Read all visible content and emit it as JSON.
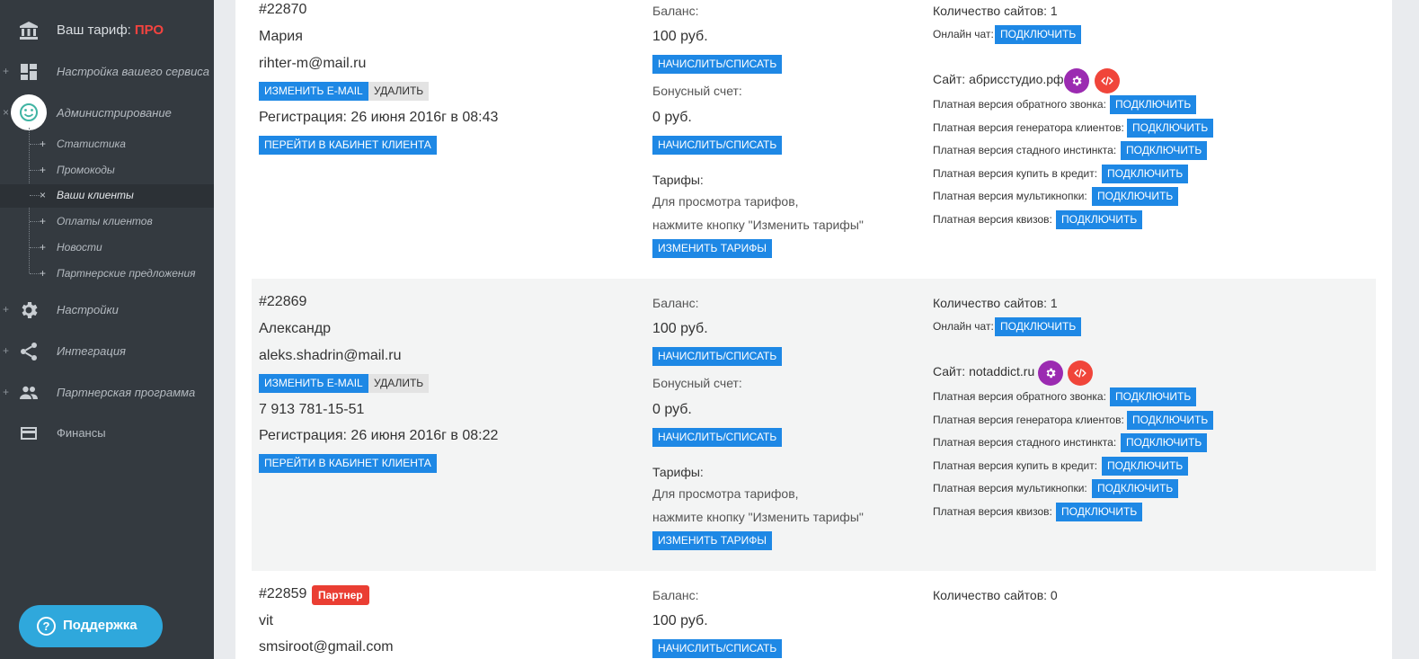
{
  "sidebar": {
    "plan_label": "Ваш тариф:",
    "plan_value": "ПРО",
    "items": [
      {
        "label": "Настройка вашего сервиса",
        "toggle": "+"
      },
      {
        "label": "Администрирование",
        "toggle": "×"
      },
      {
        "label": "Настройки",
        "toggle": "+"
      },
      {
        "label": "Интеграция",
        "toggle": "+"
      },
      {
        "label": "Партнерская программа",
        "toggle": "+"
      },
      {
        "label": "Финансы",
        "toggle": ""
      }
    ],
    "subitems": [
      {
        "label": "Статистика",
        "mark": "+"
      },
      {
        "label": "Промокоды",
        "mark": "+"
      },
      {
        "label": "Ваши клиенты",
        "mark": "×"
      },
      {
        "label": "Оплаты клиентов",
        "mark": "+"
      },
      {
        "label": "Новости",
        "mark": "+"
      },
      {
        "label": "Партнерские предложения",
        "mark": "+"
      }
    ],
    "support_label": "Поддержка",
    "support_icon": "?"
  },
  "labels": {
    "change_email": "ИЗМЕНИТЬ E-MAIL",
    "delete": "УДАЛИТЬ",
    "go_cabinet": "ПЕРЕЙТИ В КАБИНЕТ КЛИЕНТА",
    "balance": "Баланс:",
    "bonus": "Бонусный счет:",
    "charge": "НАЧИСЛИТЬ/СПИСАТЬ",
    "tariffs": "Тарифы:",
    "tariffs_hint_1": "Для просмотра тарифов,",
    "tariffs_hint_2": "нажмите кнопку \"Изменить тарифы\"",
    "change_tariffs": "ИЗМЕНИТЬ ТАРИФЫ",
    "connect": "ПОДКЛЮЧИТЬ",
    "online_chat": "Онлайн чат:",
    "site_prefix": "Сайт:",
    "paid_callback": "Платная версия обратного звонка:",
    "paid_generator": "Платная версия генератора клиентов:",
    "paid_herd": "Платная версия стадного инстинкта:",
    "paid_credit": "Платная версия купить в кредит:",
    "paid_multi": "Платная версия мультикнопки:",
    "paid_quiz": "Платная версия квизов:"
  },
  "clients": [
    {
      "id": "#22870",
      "name": "Мария",
      "email": "rihter-m@mail.ru",
      "registration": "Регистрация: 26 июня 2016г в 08:43",
      "balance": "100 руб.",
      "bonus": "0 руб.",
      "sites_count": "Количество сайтов: 1",
      "site": "абрисстудио.рф"
    },
    {
      "id": "#22869",
      "name": "Александр",
      "email": "aleks.shadrin@mail.ru",
      "phone": "7 913 781-15-51",
      "registration": "Регистрация: 26 июня 2016г в 08:22",
      "balance": "100 руб.",
      "bonus": "0 руб.",
      "sites_count": "Количество сайтов: 1",
      "site": "notaddict.ru"
    },
    {
      "id": "#22859",
      "badge": "Партнер",
      "name": "vit",
      "email": "smsiroot@gmail.com",
      "balance": "100 руб.",
      "sites_count": "Количество сайтов: 0"
    }
  ]
}
